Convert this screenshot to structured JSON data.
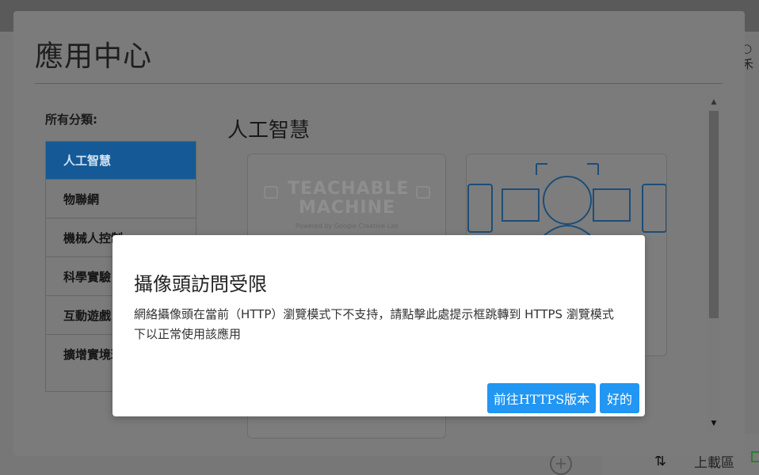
{
  "background": {
    "right_glyph": "○ 禾",
    "bottom_plus": "+",
    "bottom_arrows": "⇅",
    "bottom_text": "上載區"
  },
  "app_center": {
    "title": "應用中心",
    "categories_heading": "所有分類:",
    "categories": [
      {
        "label": "人工智慧",
        "active": true
      },
      {
        "label": "物聯網",
        "active": false
      },
      {
        "label": "機械人控制",
        "active": false
      },
      {
        "label": "科學實驗",
        "active": false
      },
      {
        "label": "互動遊戲",
        "active": false
      },
      {
        "label": "擴增實境環境",
        "active": false
      }
    ],
    "section_title": "人工智慧",
    "cards": [
      {
        "logo_line1": "TEACHABLE",
        "logo_line2": "MACHINE",
        "powered_by": "Powered by Google Creative Lab"
      }
    ]
  },
  "dialog": {
    "title": "攝像頭訪問受限",
    "message": "網絡攝像頭在當前（HTTP）瀏覽模式下不支持，請點擊此處提示框跳轉到 HTTPS 瀏覽模式下以正常使用該應用",
    "button_https": "前往HTTPS版本",
    "button_ok": "好的"
  },
  "colors": {
    "accent": "#2196f3",
    "active_category": "#155a96",
    "overlay": "#7b7b7b"
  }
}
